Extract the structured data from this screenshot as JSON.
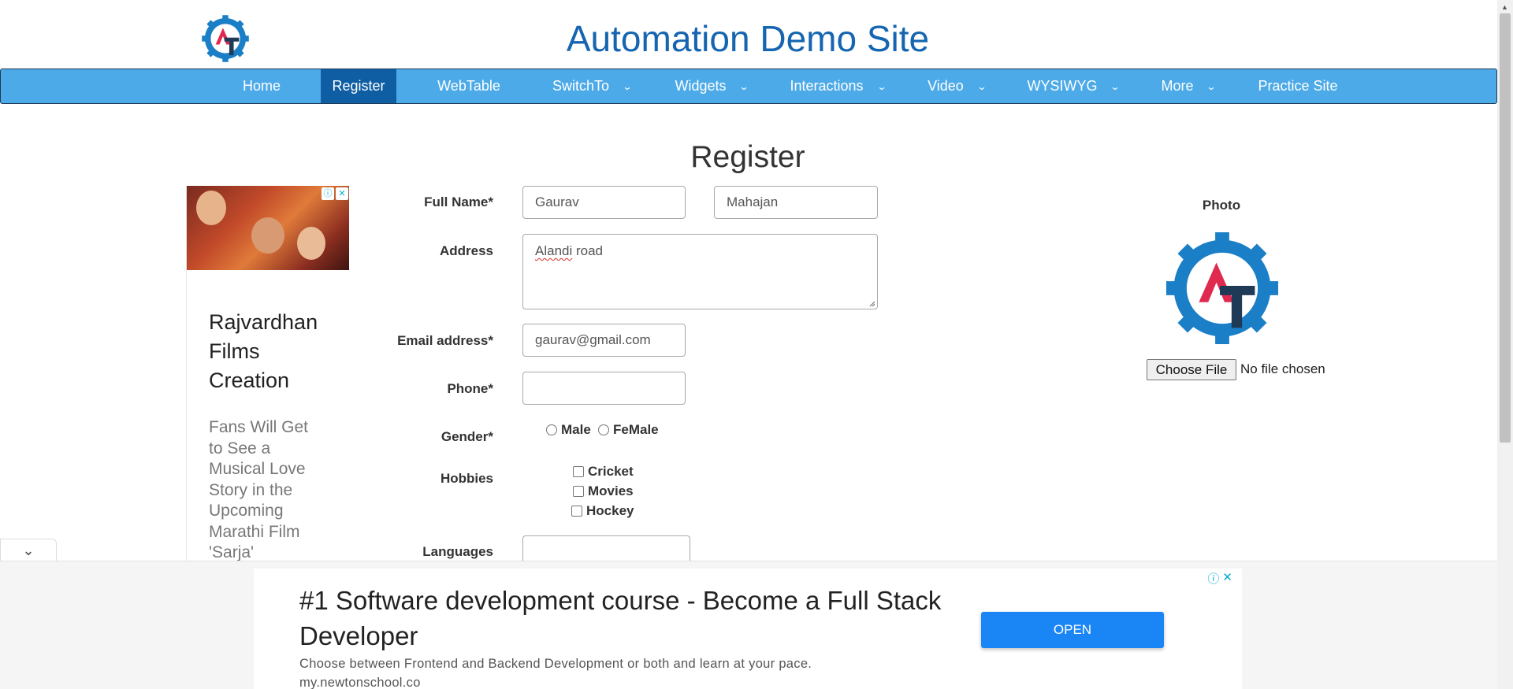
{
  "header": {
    "site_title": "Automation Demo Site",
    "logo_text": "AT"
  },
  "nav": {
    "items": [
      {
        "label": "Home",
        "dropdown": false
      },
      {
        "label": "Register",
        "dropdown": false,
        "active": true
      },
      {
        "label": "WebTable",
        "dropdown": false
      },
      {
        "label": "SwitchTo",
        "dropdown": true
      },
      {
        "label": "Widgets",
        "dropdown": true
      },
      {
        "label": "Interactions",
        "dropdown": true
      },
      {
        "label": "Video",
        "dropdown": true
      },
      {
        "label": "WYSIWYG",
        "dropdown": true
      },
      {
        "label": "More",
        "dropdown": true
      },
      {
        "label": "Practice Site",
        "dropdown": false
      }
    ],
    "chevron": "⌄"
  },
  "page": {
    "heading": "Register"
  },
  "form": {
    "full_name_label": "Full Name*",
    "first_name_value": "Gaurav",
    "last_name_value": "Mahajan",
    "address_label": "Address",
    "address_word1": "Alandi",
    "address_word2": " road",
    "email_label": "Email address*",
    "email_value": "gaurav@gmail.com",
    "phone_label": "Phone*",
    "phone_value": "",
    "gender_label": "Gender*",
    "gender_options": [
      "Male",
      "FeMale"
    ],
    "hobbies_label": "Hobbies",
    "hobbies": [
      "Cricket",
      "Movies",
      "Hockey"
    ],
    "languages_label": "Languages"
  },
  "photo": {
    "label": "Photo",
    "choose_file_label": "Choose File",
    "file_status": "No file chosen"
  },
  "left_ad": {
    "title": "Rajvardhan Films Creation",
    "description": "Fans Will Get to See a Musical Love Story in the Upcoming Marathi Film 'Sarja'",
    "info_icon": "ⓘ",
    "close_icon": "✕"
  },
  "bottom_ad": {
    "headline": "#1 Software development course - Become a Full Stack Developer",
    "description": "Choose between Frontend and Backend Development or both and learn at your pace.",
    "url": "my.newtonschool.co",
    "open_label": "OPEN",
    "info_icon": "ⓘ",
    "close_icon": "✕",
    "collapse_icon": "⌄"
  },
  "colors": {
    "title_blue": "#1565b0",
    "nav_bg": "#4daae8",
    "nav_active": "#0f5ea3",
    "logo_blue": "#1a7fc7",
    "logo_red": "#e0294e",
    "logo_dark": "#1f3a57",
    "open_button": "#1a86f6"
  }
}
